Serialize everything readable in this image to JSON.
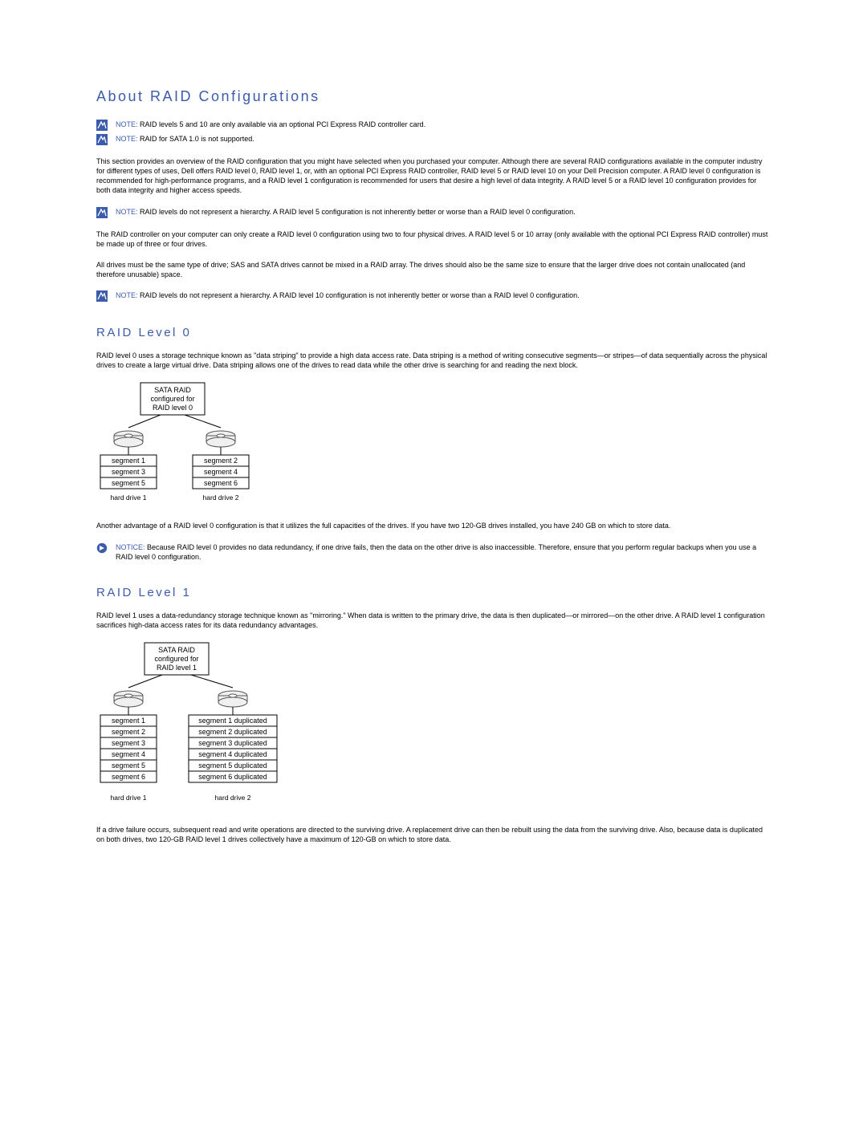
{
  "title": "About RAID Configurations",
  "notes": {
    "n1": "RAID levels 5 and 10 are only available via an optional PCI Express RAID controller card.",
    "n2": "RAID for SATA 1.0 is not supported.",
    "n3": "RAID levels do not represent a hierarchy. A RAID level 5 configuration is not inherently better or worse than a RAID level 0 configuration.",
    "n4": "RAID levels do not represent a hierarchy. A RAID level 10 configuration is not inherently better or worse than a RAID level 0 configuration."
  },
  "noteLabel": "NOTE: ",
  "noticeLabel": "NOTICE: ",
  "para": {
    "intro": "This section provides an overview of the RAID configuration that you might have selected when you purchased your computer. Although there are several RAID configurations available in the computer industry for different types of uses, Dell offers RAID level 0, RAID level 1, or, with an optional PCI Express RAID controller, RAID level 5 or RAID level 10 on your Dell Precision computer. A RAID level 0 configuration is recommended for high-performance programs, and a RAID level 1 configuration is recommended for users that desire a high level of data integrity. A RAID level 5 or a RAID level 10 configuration provides for both data integrity and higher access speeds.",
    "controller": "The RAID controller on your computer can only create a RAID level 0 configuration using two to four physical drives. A RAID level 5 or 10 array (only available with the optional PCI Express RAID controller) must be made up of three or four drives.",
    "drives": "All drives must be the same type of drive; SAS and SATA drives cannot be mixed in a RAID array. The drives should also be the same size to ensure that the larger drive does not contain unallocated (and therefore unusable) space.",
    "r0_p1": "RAID level 0 uses a storage technique known as \"data striping\" to provide a high data access rate. Data striping is a method of writing consecutive segments—or stripes—of data sequentially across the physical drives to create a large virtual drive. Data striping allows one of the drives to read data while the other drive is searching for and reading the next block.",
    "r0_p2": "Another advantage of a RAID level 0 configuration is that it utilizes the full capacities of the drives. If you have two 120-GB drives installed, you have 240 GB on which to store data.",
    "r1_p1": "RAID level 1 uses a data-redundancy storage technique known as \"mirroring.\" When data is written to the primary drive, the data is then duplicated—or mirrored—on the other drive. A RAID level 1 configuration sacrifices high-data access rates for its data redundancy advantages.",
    "r1_p2": "If a drive failure occurs, subsequent read and write operations are directed to the surviving drive. A replacement drive can then be rebuilt using the data from the surviving drive. Also, because data is duplicated on both drives, two 120-GB RAID level 1 drives collectively have a maximum of 120-GB on which to store data."
  },
  "notice": {
    "r0": "Because RAID level 0 provides no data redundancy, if one drive fails, then the data on the other drive is also inaccessible. Therefore, ensure that you perform regular backups when you use a RAID level 0 configuration."
  },
  "headings": {
    "r0": "RAID Level 0",
    "r1": "RAID Level 1"
  },
  "diag0": {
    "top1": "SATA RAID",
    "top2": "configured for",
    "top3": "RAID level 0",
    "left": [
      "segment 1",
      "segment 3",
      "segment 5"
    ],
    "right": [
      "segment 2",
      "segment 4",
      "segment 6"
    ],
    "hd1": "hard drive 1",
    "hd2": "hard drive 2"
  },
  "diag1": {
    "top1": "SATA RAID",
    "top2": "configured for",
    "top3": "RAID level 1",
    "left": [
      "segment 1",
      "segment 2",
      "segment 3",
      "segment 4",
      "segment 5",
      "segment 6"
    ],
    "right": [
      "segment 1 duplicated",
      "segment 2 duplicated",
      "segment 3 duplicated",
      "segment 4 duplicated",
      "segment 5 duplicated",
      "segment 6 duplicated"
    ],
    "hd1": "hard drive 1",
    "hd2": "hard drive 2"
  }
}
